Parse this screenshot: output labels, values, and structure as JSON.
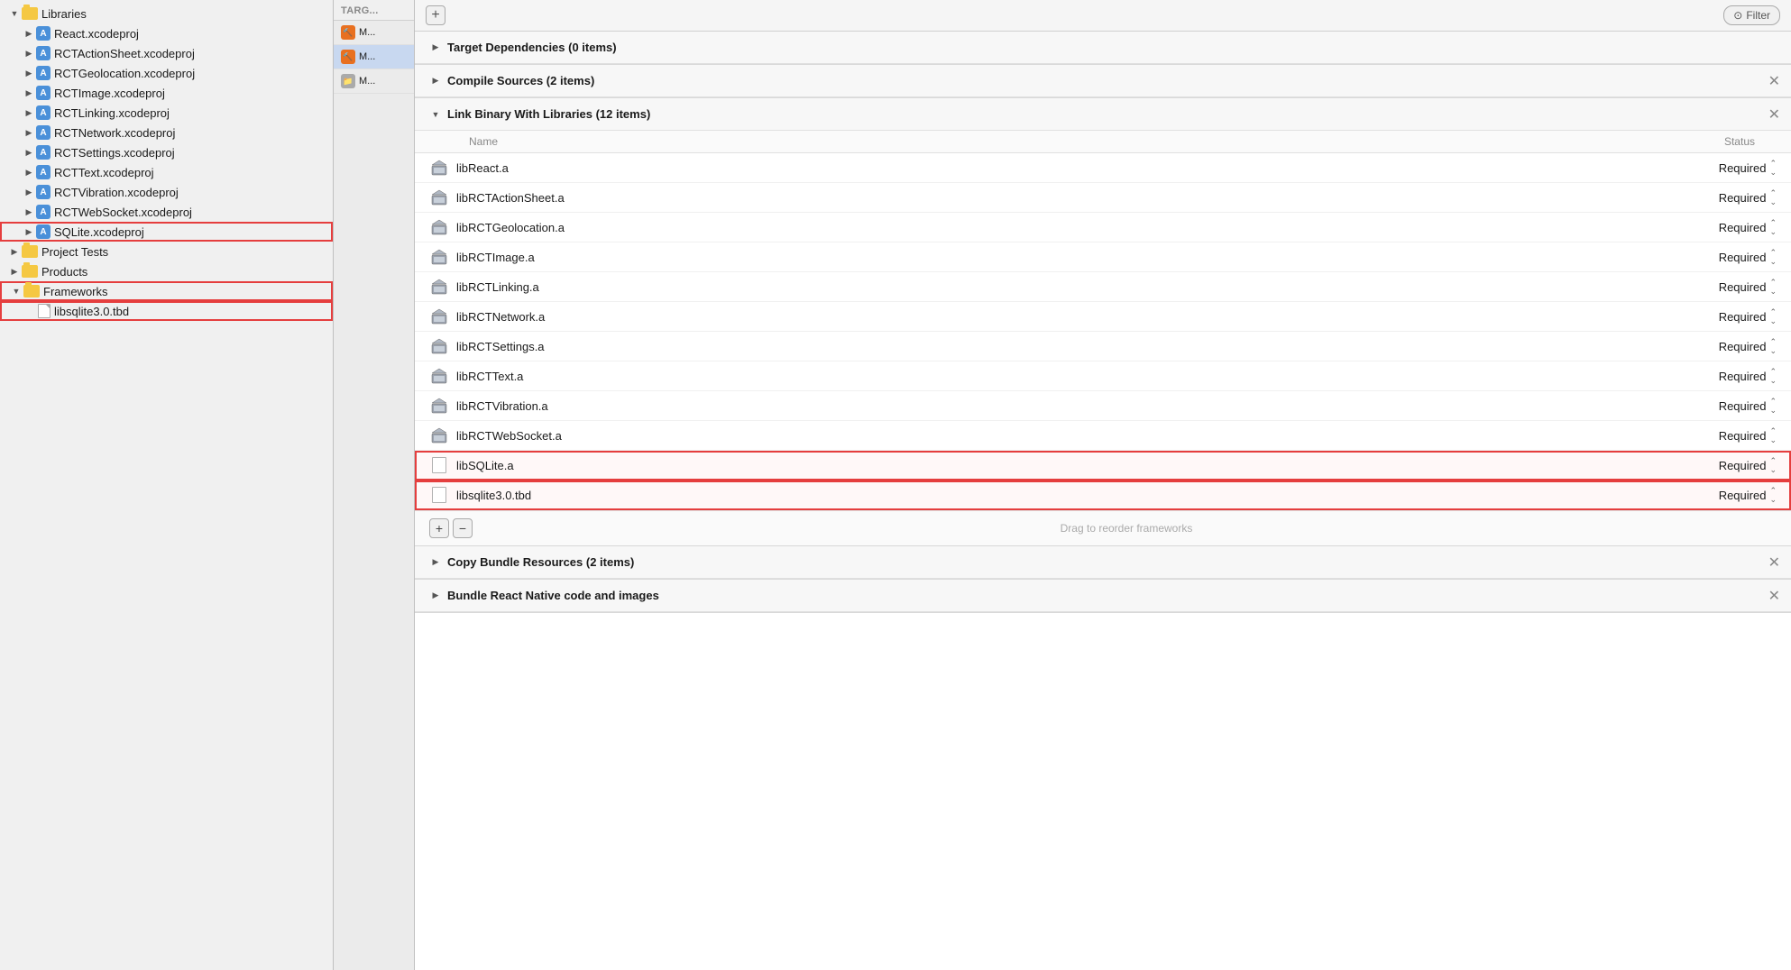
{
  "leftPanel": {
    "items": [
      {
        "id": "libraries",
        "label": "Libraries",
        "indent": 0,
        "type": "folder",
        "open": true,
        "highlighted": false
      },
      {
        "id": "react-xcodeproj",
        "label": "React.xcodeproj",
        "indent": 1,
        "type": "xcodeproj",
        "open": false,
        "highlighted": false
      },
      {
        "id": "rctactionsheet-xcodeproj",
        "label": "RCTActionSheet.xcodeproj",
        "indent": 1,
        "type": "xcodeproj",
        "open": false,
        "highlighted": false
      },
      {
        "id": "rctgeolocation-xcodeproj",
        "label": "RCTGeolocation.xcodeproj",
        "indent": 1,
        "type": "xcodeproj",
        "open": false,
        "highlighted": false
      },
      {
        "id": "rctimage-xcodeproj",
        "label": "RCTImage.xcodeproj",
        "indent": 1,
        "type": "xcodeproj",
        "open": false,
        "highlighted": false
      },
      {
        "id": "rctlinking-xcodeproj",
        "label": "RCTLinking.xcodeproj",
        "indent": 1,
        "type": "xcodeproj",
        "open": false,
        "highlighted": false
      },
      {
        "id": "rctnetwork-xcodeproj",
        "label": "RCTNetwork.xcodeproj",
        "indent": 1,
        "type": "xcodeproj",
        "open": false,
        "highlighted": false
      },
      {
        "id": "rctsettings-xcodeproj",
        "label": "RCTSettings.xcodeproj",
        "indent": 1,
        "type": "xcodeproj",
        "open": false,
        "highlighted": false
      },
      {
        "id": "rcttext-xcodeproj",
        "label": "RCTText.xcodeproj",
        "indent": 1,
        "type": "xcodeproj",
        "open": false,
        "highlighted": false
      },
      {
        "id": "rctvibration-xcodeproj",
        "label": "RCTVibration.xcodeproj",
        "indent": 1,
        "type": "xcodeproj",
        "open": false,
        "highlighted": false
      },
      {
        "id": "rctwebsocket-xcodeproj",
        "label": "RCTWebSocket.xcodeproj",
        "indent": 1,
        "type": "xcodeproj",
        "open": false,
        "highlighted": false
      },
      {
        "id": "sqlite-xcodeproj",
        "label": "SQLite.xcodeproj",
        "indent": 1,
        "type": "xcodeproj",
        "open": false,
        "highlighted": true
      },
      {
        "id": "project-tests",
        "label": "Project Tests",
        "indent": 0,
        "type": "folder",
        "open": false,
        "highlighted": false
      },
      {
        "id": "products",
        "label": "Products",
        "indent": 0,
        "type": "folder",
        "open": false,
        "highlighted": false
      },
      {
        "id": "frameworks",
        "label": "Frameworks",
        "indent": 0,
        "type": "folder",
        "open": true,
        "highlighted": true
      },
      {
        "id": "libsqlite3-tbd",
        "label": "libsqlite3.0.tbd",
        "indent": 1,
        "type": "file",
        "open": false,
        "highlighted": true
      }
    ]
  },
  "targetsPanel": {
    "header": "TARG...",
    "items": [
      {
        "id": "target-m1",
        "label": "M...",
        "type": "target-orange"
      },
      {
        "id": "target-m2",
        "label": "M...",
        "type": "target-orange",
        "selected": true
      },
      {
        "id": "target-m3",
        "label": "M...",
        "type": "target-folder"
      }
    ]
  },
  "topBar": {
    "addLabel": "+",
    "filterLabel": "Filter"
  },
  "sections": [
    {
      "id": "target-dependencies",
      "title": "Target Dependencies (0 items)",
      "open": false,
      "showClose": false,
      "items": []
    },
    {
      "id": "compile-sources",
      "title": "Compile Sources (2 items)",
      "open": false,
      "showClose": true,
      "items": []
    },
    {
      "id": "link-binary",
      "title": "Link Binary With Libraries (12 items)",
      "open": true,
      "showClose": true,
      "columnHeaders": {
        "name": "Name",
        "status": "Status"
      },
      "items": [
        {
          "name": "libReact.a",
          "status": "Required",
          "type": "lib",
          "highlighted": false
        },
        {
          "name": "libRCTActionSheet.a",
          "status": "Required",
          "type": "lib",
          "highlighted": false
        },
        {
          "name": "libRCTGeolocation.a",
          "status": "Required",
          "type": "lib",
          "highlighted": false
        },
        {
          "name": "libRCTImage.a",
          "status": "Required",
          "type": "lib",
          "highlighted": false
        },
        {
          "name": "libRCTLinking.a",
          "status": "Required",
          "type": "lib",
          "highlighted": false
        },
        {
          "name": "libRCTNetwork.a",
          "status": "Required",
          "type": "lib",
          "highlighted": false
        },
        {
          "name": "libRCTSettings.a",
          "status": "Required",
          "type": "lib",
          "highlighted": false
        },
        {
          "name": "libRCTText.a",
          "status": "Required",
          "type": "lib",
          "highlighted": false
        },
        {
          "name": "libRCTVibration.a",
          "status": "Required",
          "type": "lib",
          "highlighted": false
        },
        {
          "name": "libRCTWebSocket.a",
          "status": "Required",
          "type": "lib",
          "highlighted": false
        },
        {
          "name": "libSQLite.a",
          "status": "Required",
          "type": "file",
          "highlighted": true
        },
        {
          "name": "libsqlite3.0.tbd",
          "status": "Required",
          "type": "file",
          "highlighted": true
        }
      ],
      "bottomActions": {
        "addLabel": "+",
        "removeLabel": "−",
        "dragHint": "Drag to reorder frameworks"
      }
    },
    {
      "id": "copy-bundle-resources",
      "title": "Copy Bundle Resources (2 items)",
      "open": false,
      "showClose": true,
      "items": []
    },
    {
      "id": "bundle-react-native",
      "title": "Bundle React Native code and images",
      "open": false,
      "showClose": true,
      "items": []
    }
  ]
}
